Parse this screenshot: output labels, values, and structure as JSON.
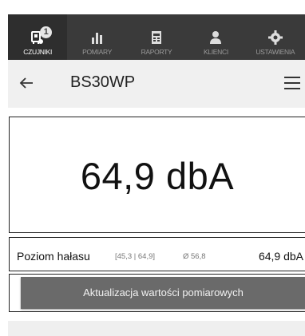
{
  "nav": {
    "items": [
      {
        "label": "CZUJNIKI",
        "icon": "sensor-icon",
        "badge": "1",
        "active": true
      },
      {
        "label": "POMIARY",
        "icon": "bar-chart-icon",
        "active": false
      },
      {
        "label": "RAPORTY",
        "icon": "report-icon",
        "active": false
      },
      {
        "label": "KLIENCI",
        "icon": "users-icon",
        "active": false
      },
      {
        "label": "USTAWIENIA",
        "icon": "gear-icon",
        "active": false
      }
    ]
  },
  "header": {
    "title": "BS30WP"
  },
  "main": {
    "big_value": "64,9 dbA"
  },
  "readout": {
    "name": "Poziom hałasu",
    "range": "[45,3 | 64,9]",
    "avg": "Ø 56,8",
    "value": "64,9 dbA"
  },
  "actions": {
    "update_label": "Aktualizacja wartości pomiarowych"
  },
  "colors": {
    "nav_bg": "#3a3a3a",
    "header_bg": "#f0f0f0",
    "button_bg": "#6a6a6a"
  }
}
